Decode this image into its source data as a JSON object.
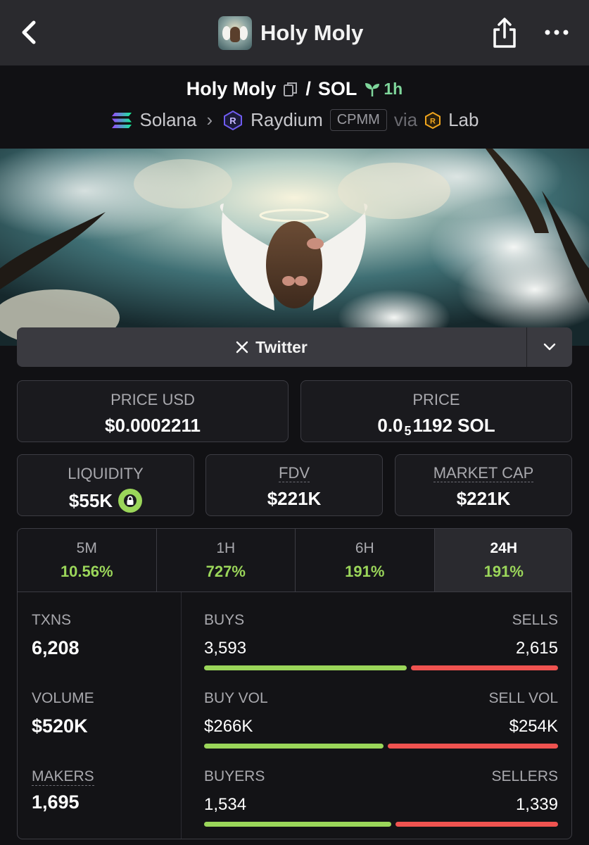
{
  "header": {
    "title": "Holy Moly"
  },
  "pair": {
    "base": "Holy Moly",
    "separator": "/",
    "quote": "SOL",
    "age": "1h",
    "chain": "Solana",
    "dex": "Raydium",
    "pool_type": "CPMM",
    "via_label": "via",
    "launchpad": "Lab"
  },
  "social": {
    "twitter_label": "Twitter"
  },
  "stats": {
    "price_usd_label": "PRICE USD",
    "price_usd": "$0.0002211",
    "price_label": "PRICE",
    "price_lead": "0.0",
    "price_sub": "5",
    "price_tail": "1192 SOL",
    "liquidity_label": "LIQUIDITY",
    "liquidity": "$55K",
    "fdv_label": "FDV",
    "fdv": "$221K",
    "mcap_label": "MARKET CAP",
    "mcap": "$221K"
  },
  "periods": [
    {
      "label": "5M",
      "change": "10.56%"
    },
    {
      "label": "1H",
      "change": "727%"
    },
    {
      "label": "6H",
      "change": "191%"
    },
    {
      "label": "24H",
      "change": "191%",
      "active": true
    }
  ],
  "metrics": {
    "txns_label": "TXNS",
    "txns": "6,208",
    "volume_label": "VOLUME",
    "volume": "$520K",
    "makers_label": "MAKERS",
    "makers": "1,695"
  },
  "breakdown": {
    "buys_label": "BUYS",
    "buys": "3,593",
    "sells_label": "SELLS",
    "sells": "2,615",
    "buy_share": 0.579,
    "buy_vol_label": "BUY VOL",
    "buy_vol": "$266K",
    "sell_vol_label": "SELL VOL",
    "sell_vol": "$254K",
    "buy_vol_share": 0.512,
    "buyers_label": "BUYERS",
    "buyers": "1,534",
    "sellers_label": "SELLERS",
    "sellers": "1,339",
    "buyers_share": 0.534
  },
  "colors": {
    "accent_green": "#9bd65a",
    "sell_red": "#ef5350",
    "age_green": "#7fd69b"
  },
  "icons": [
    "back-icon",
    "share-icon",
    "more-icon",
    "copy-icon",
    "sprout-icon",
    "solana-icon",
    "raydium-icon",
    "lab-icon",
    "x-icon",
    "chevron-down-icon",
    "lock-icon"
  ]
}
